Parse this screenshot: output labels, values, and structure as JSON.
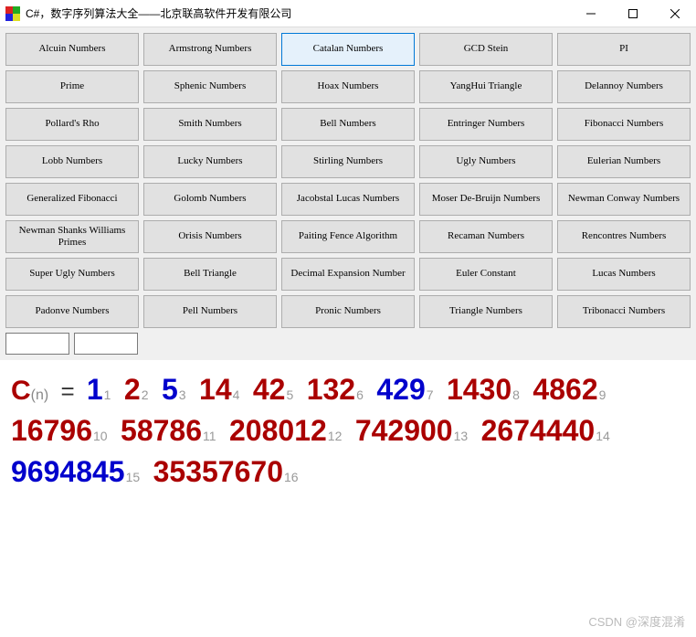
{
  "window": {
    "title": "C#，数字序列算法大全——北京联高软件开发有限公司"
  },
  "buttons": [
    {
      "label": "Alcuin Numbers",
      "selected": false
    },
    {
      "label": "Armstrong Numbers",
      "selected": false
    },
    {
      "label": "Catalan Numbers",
      "selected": true
    },
    {
      "label": "GCD Stein",
      "selected": false
    },
    {
      "label": "PI",
      "selected": false
    },
    {
      "label": "Prime",
      "selected": false
    },
    {
      "label": "Sphenic Numbers",
      "selected": false
    },
    {
      "label": "Hoax Numbers",
      "selected": false
    },
    {
      "label": "YangHui Triangle",
      "selected": false
    },
    {
      "label": "Delannoy Numbers",
      "selected": false
    },
    {
      "label": "Pollard's Rho",
      "selected": false
    },
    {
      "label": "Smith Numbers",
      "selected": false
    },
    {
      "label": "Bell Numbers",
      "selected": false
    },
    {
      "label": "Entringer Numbers",
      "selected": false
    },
    {
      "label": "Fibonacci Numbers",
      "selected": false
    },
    {
      "label": "Lobb Numbers",
      "selected": false
    },
    {
      "label": "Lucky Numbers",
      "selected": false
    },
    {
      "label": "Stirling Numbers",
      "selected": false
    },
    {
      "label": "Ugly Numbers",
      "selected": false
    },
    {
      "label": "Eulerian Numbers",
      "selected": false
    },
    {
      "label": "Generalized Fibonacci",
      "selected": false
    },
    {
      "label": "Golomb Numbers",
      "selected": false
    },
    {
      "label": "Jacobstal Lucas Numbers",
      "selected": false
    },
    {
      "label": "Moser De-Bruijn Numbers",
      "selected": false
    },
    {
      "label": "Newman Conway Numbers",
      "selected": false
    },
    {
      "label": "Newman Shanks Williams Primes",
      "selected": false
    },
    {
      "label": "Orisis Numbers",
      "selected": false
    },
    {
      "label": "Paiting Fence Algorithm",
      "selected": false
    },
    {
      "label": "Recaman Numbers",
      "selected": false
    },
    {
      "label": "Rencontres Numbers",
      "selected": false
    },
    {
      "label": "Super Ugly Numbers",
      "selected": false
    },
    {
      "label": "Bell Triangle",
      "selected": false
    },
    {
      "label": "Decimal Expansion Number",
      "selected": false
    },
    {
      "label": "Euler Constant",
      "selected": false
    },
    {
      "label": "Lucas Numbers",
      "selected": false
    },
    {
      "label": "Padonve Numbers",
      "selected": false
    },
    {
      "label": "Pell Numbers",
      "selected": false
    },
    {
      "label": "Pronic Numbers",
      "selected": false
    },
    {
      "label": "Triangle Numbers",
      "selected": false
    },
    {
      "label": "Tribonacci Numbers",
      "selected": false
    }
  ],
  "output": {
    "prefix": "C",
    "prefix_sub": "(n)",
    "eq": "=",
    "sequence": [
      {
        "idx": "1",
        "val": "1",
        "color": "blue"
      },
      {
        "idx": "2",
        "val": "2",
        "color": "red"
      },
      {
        "idx": "3",
        "val": "5",
        "color": "blue"
      },
      {
        "idx": "4",
        "val": "14",
        "color": "red"
      },
      {
        "idx": "5",
        "val": "42",
        "color": "red"
      },
      {
        "idx": "6",
        "val": "132",
        "color": "red"
      },
      {
        "idx": "7",
        "val": "429",
        "color": "blue"
      },
      {
        "idx": "8",
        "val": "1430",
        "color": "red"
      },
      {
        "idx": "9",
        "val": "4862",
        "color": "red"
      },
      {
        "idx": "10",
        "val": "16796",
        "color": "red"
      },
      {
        "idx": "11",
        "val": "58786",
        "color": "red"
      },
      {
        "idx": "12",
        "val": "208012",
        "color": "red"
      },
      {
        "idx": "13",
        "val": "742900",
        "color": "red"
      },
      {
        "idx": "14",
        "val": "2674440",
        "color": "red"
      },
      {
        "idx": "15",
        "val": "9694845",
        "color": "blue"
      },
      {
        "idx": "16",
        "val": "35357670",
        "color": "red"
      }
    ]
  },
  "watermark": "CSDN @深度混淆"
}
